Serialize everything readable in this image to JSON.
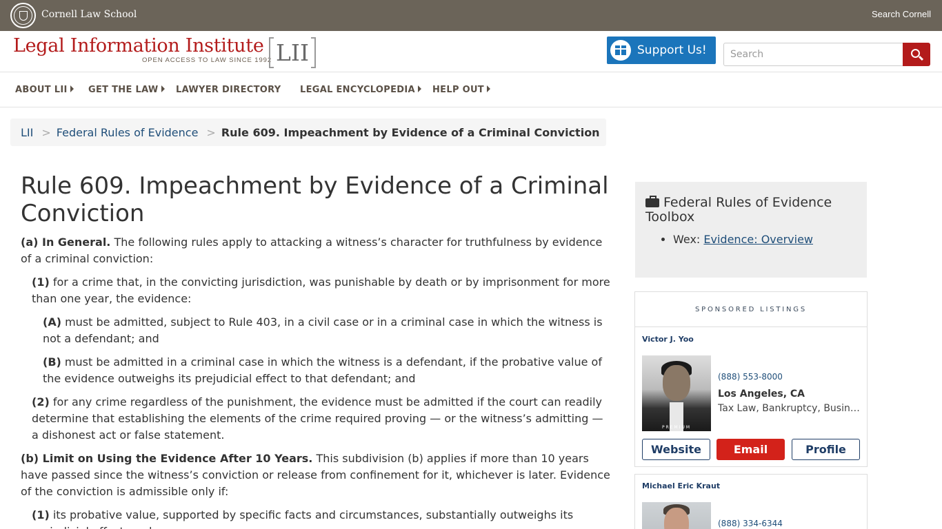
{
  "top_bar": {
    "institution": "Cornell Law School",
    "search_link": "Search Cornell"
  },
  "header": {
    "logo_text": "Legal Information Institute",
    "logo_tagline": "OPEN ACCESS TO LAW SINCE 1992",
    "logo_mark": "LII",
    "support_label": "Support Us!",
    "search_placeholder": "Search"
  },
  "nav": {
    "items": [
      {
        "label": "ABOUT LII",
        "has_caret": true
      },
      {
        "label": "GET THE LAW",
        "has_caret": true
      },
      {
        "label": "LAWYER DIRECTORY",
        "has_caret": false
      },
      {
        "label": "LEGAL ENCYCLOPEDIA",
        "has_caret": true
      },
      {
        "label": "HELP OUT",
        "has_caret": true
      }
    ]
  },
  "breadcrumb": {
    "items": [
      "LII",
      "Federal Rules of Evidence"
    ],
    "separator": ">",
    "current": "Rule 609. Impeachment by Evidence of a Criminal Conviction"
  },
  "main": {
    "title": "Rule 609. Impeachment by Evidence of a Criminal Conviction",
    "paragraphs": [
      {
        "label": "(a) In General.",
        "text": " The following rules apply to attacking a witness’s character for truthfulness by evidence of a criminal conviction:"
      },
      {
        "label": "(1)",
        "text": " for a crime that, in the convicting jurisdiction, was punishable by death or by imprisonment for more than one year, the evidence:"
      },
      {
        "label": "(A)",
        "text": " must be admitted, subject to Rule 403, in a civil case or in a criminal case in which the witness is not a defendant; and"
      },
      {
        "label": "(B)",
        "text": " must be admitted in a criminal case in which the witness is a defendant, if the probative value of the evidence outweighs its prejudicial effect to that defendant; and"
      },
      {
        "label": "(2)",
        "text": " for any crime regardless of the punishment, the evidence must be admitted if the court can readily determine that establishing the elements of the crime required proving — or the witness’s admitting — a dishonest act or false statement."
      },
      {
        "label": "(b) Limit on Using the Evidence After 10 Years.",
        "text": " This subdivision (b) applies if more than 10 years have passed since the witness’s conviction or release from confinement for it, whichever is later. Evidence of the conviction is admissible only if:"
      },
      {
        "label": "(1)",
        "text": " its probative value, supported by specific facts and circumstances, substantially outweighs its prejudicial effect; and"
      }
    ]
  },
  "sidebar": {
    "toolbox_title": "Federal Rules of Evidence Toolbox",
    "toolbox_item_prefix": "Wex:",
    "toolbox_item_link": "Evidence: Overview",
    "sponsored_heading": "SPONSORED LISTINGS",
    "listings": [
      {
        "name": "Victor J. Yoo",
        "phone": "(888) 553-8000",
        "location": "Los Angeles, CA",
        "practice": "Tax Law, Bankruptcy, Business Law",
        "badge": "PREMIUM",
        "buttons": [
          "Website",
          "Email",
          "Profile"
        ]
      },
      {
        "name": "Michael Eric Kraut",
        "phone": "(888) 334-6344"
      }
    ]
  },
  "colors": {
    "top_bar": "#6b6459",
    "brand_red": "#b31b1b",
    "support_blue": "#1b75bb",
    "link_blue": "#1f4e79",
    "email_red": "#d3221a"
  },
  "icons": [
    "cornell-seal-icon",
    "gift-icon",
    "search-icon",
    "briefcase-icon",
    "caret-right-icon"
  ]
}
